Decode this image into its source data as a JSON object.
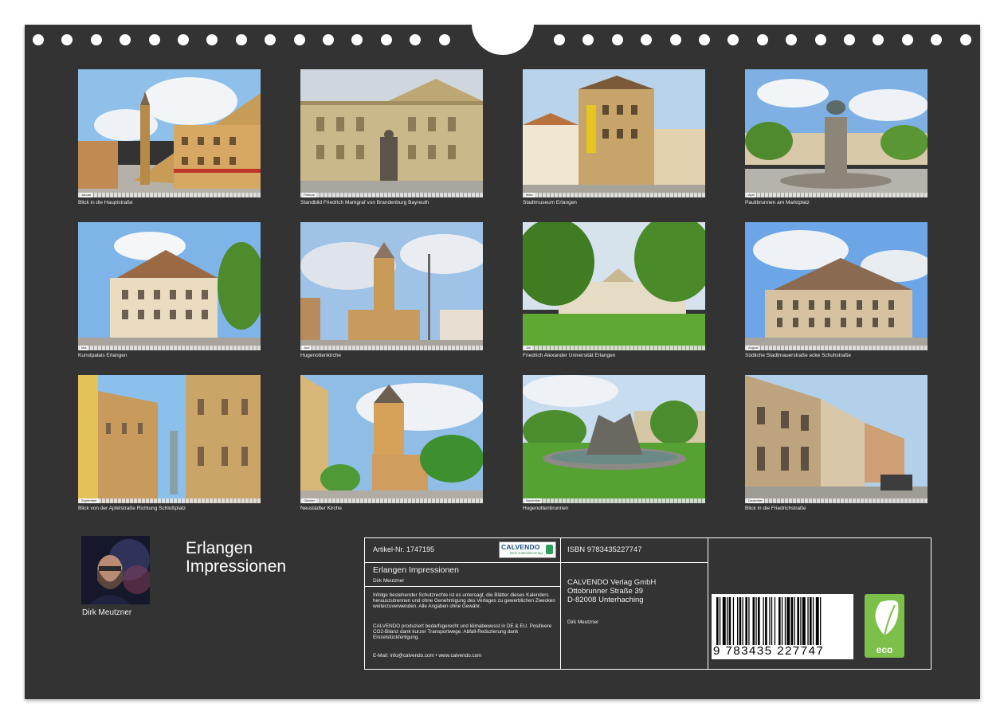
{
  "calendar": {
    "title": "Erlangen\nImpressionen",
    "author": "Dirk Meutzner",
    "months": [
      {
        "caption": "Blick in die Hauptstraße",
        "month": "Januar"
      },
      {
        "caption": "Standbild Friedrich Markgraf von Brandenburg Bayreuth",
        "month": "Februar"
      },
      {
        "caption": "Stadtmuseum Erlangen",
        "month": "März"
      },
      {
        "caption": "Paulibrunnen am Marktplatz",
        "month": "April"
      },
      {
        "caption": "Kunstpalais Erlangen",
        "month": "Mai"
      },
      {
        "caption": "Hugenottenkirche",
        "month": "Juni"
      },
      {
        "caption": "Friedrich Alexander Universität Erlangen",
        "month": "Juli"
      },
      {
        "caption": "Südliche Stadtmauerstraße ecke Schuhstraße",
        "month": "August"
      },
      {
        "caption": "Blick von der Apfelstraße Richtung Schloßplatz",
        "month": "September"
      },
      {
        "caption": "Neustädter Kirche",
        "month": "Oktober"
      },
      {
        "caption": "Hugenottenbrunnen",
        "month": "November"
      },
      {
        "caption": "Blick in die Friedrichstraße",
        "month": "Dezember"
      }
    ]
  },
  "info": {
    "article": "Artikel-Nr. 1747195",
    "logo_word": "CALVENDO",
    "logo_sub": "Dein Kalenderverlag",
    "product_title": "Erlangen Impressionen",
    "product_author": "Dirk Meutzner",
    "legal_1": "Infolge bestehender Schutzrechte ist es untersagt, die Blätter dieses Kalenders herauszutrennen und ohne Genehmigung des Verlages zu gewerblichen Zwecken weiterzuverwenden. Alle Angaben ohne Gewähr.",
    "legal_2": "CALVENDO produziert bedarfsgerecht und klimabewusst in DE & EU. Positivere CO2-Bilanz dank kurzer Transportwege. Abfall-Reduzierung dank Einzelstückfertigung.",
    "contact": "E-Mail: info@calvendo.com • www.calvendo.com",
    "isbn": "ISBN 9783435227747",
    "publisher_line1": "CALVENDO Verlag GmbH",
    "publisher_line2": "Ottobrunner Straße 39",
    "publisher_line3": "D-82008 Unterhaching",
    "publisher_author": "Dirk Meutzner",
    "barcode_digits": "9 783435 227747",
    "eco_label": "eco"
  },
  "colors": {
    "board": "#333333",
    "eco_green": "#7cc04a",
    "calvendo_blue": "#1d4b82"
  }
}
